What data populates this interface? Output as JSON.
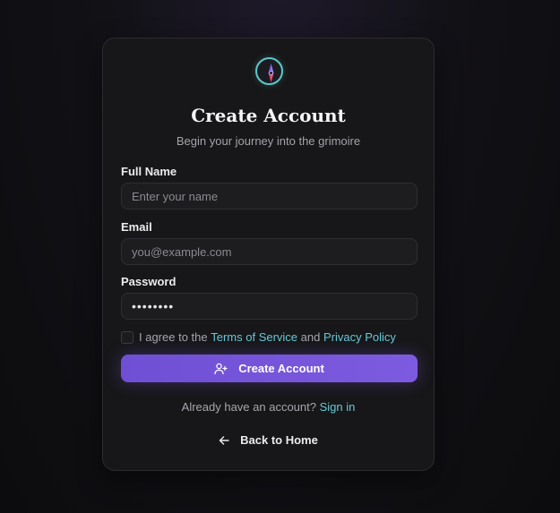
{
  "header": {
    "title": "Create Account",
    "subtitle": "Begin your journey into the grimoire",
    "logo_icon": "compass-icon"
  },
  "form": {
    "full_name": {
      "label": "Full Name",
      "placeholder": "Enter your name",
      "value": ""
    },
    "email": {
      "label": "Email",
      "placeholder": "you@example.com",
      "value": ""
    },
    "password": {
      "label": "Password",
      "value": "••••••••"
    },
    "agree": {
      "checked": false,
      "prefix": "I agree to the ",
      "terms_link": "Terms of Service",
      "middle": " and ",
      "privacy_link": "Privacy Policy"
    },
    "submit": {
      "label": "Create Account",
      "icon": "user-plus-icon"
    }
  },
  "footer": {
    "signin_prompt": "Already have an account? ",
    "signin_link": "Sign in",
    "back_label": "Back to Home",
    "back_icon": "arrow-left-icon"
  },
  "colors": {
    "accent": "#7a57de",
    "link": "#67c9d6",
    "card_bg": "#171719",
    "page_bg": "#0e0e10"
  }
}
